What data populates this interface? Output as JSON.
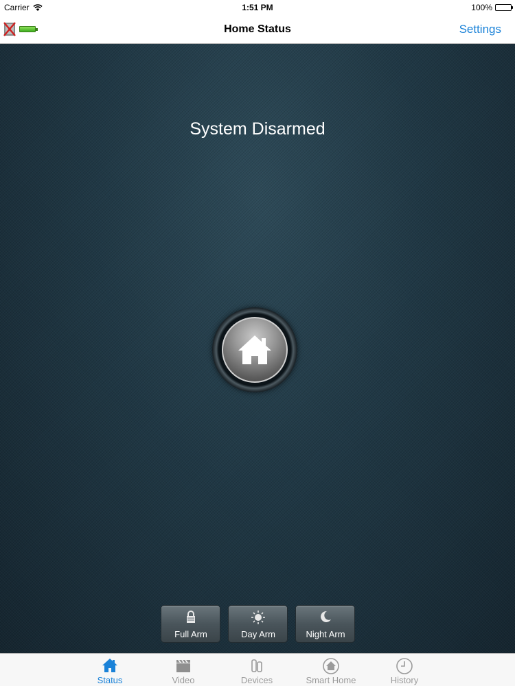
{
  "status_bar": {
    "carrier": "Carrier",
    "time": "1:51 PM",
    "battery": "100%"
  },
  "nav": {
    "title": "Home Status",
    "settings_label": "Settings"
  },
  "main": {
    "status_text": "System Disarmed"
  },
  "arm_buttons": [
    {
      "label": "Full Arm",
      "icon": "lock-icon"
    },
    {
      "label": "Day Arm",
      "icon": "sun-icon"
    },
    {
      "label": "Night Arm",
      "icon": "moon-icon"
    }
  ],
  "tabs": [
    {
      "label": "Status",
      "icon": "home-icon",
      "active": true
    },
    {
      "label": "Video",
      "icon": "clapperboard-icon",
      "active": false
    },
    {
      "label": "Devices",
      "icon": "sensor-icon",
      "active": false
    },
    {
      "label": "Smart Home",
      "icon": "smart-home-icon",
      "active": false
    },
    {
      "label": "History",
      "icon": "clock-icon",
      "active": false
    }
  ],
  "colors": {
    "accent": "#1a82d8",
    "background": "#1f3643",
    "tab_inactive": "#9a9a9a"
  }
}
